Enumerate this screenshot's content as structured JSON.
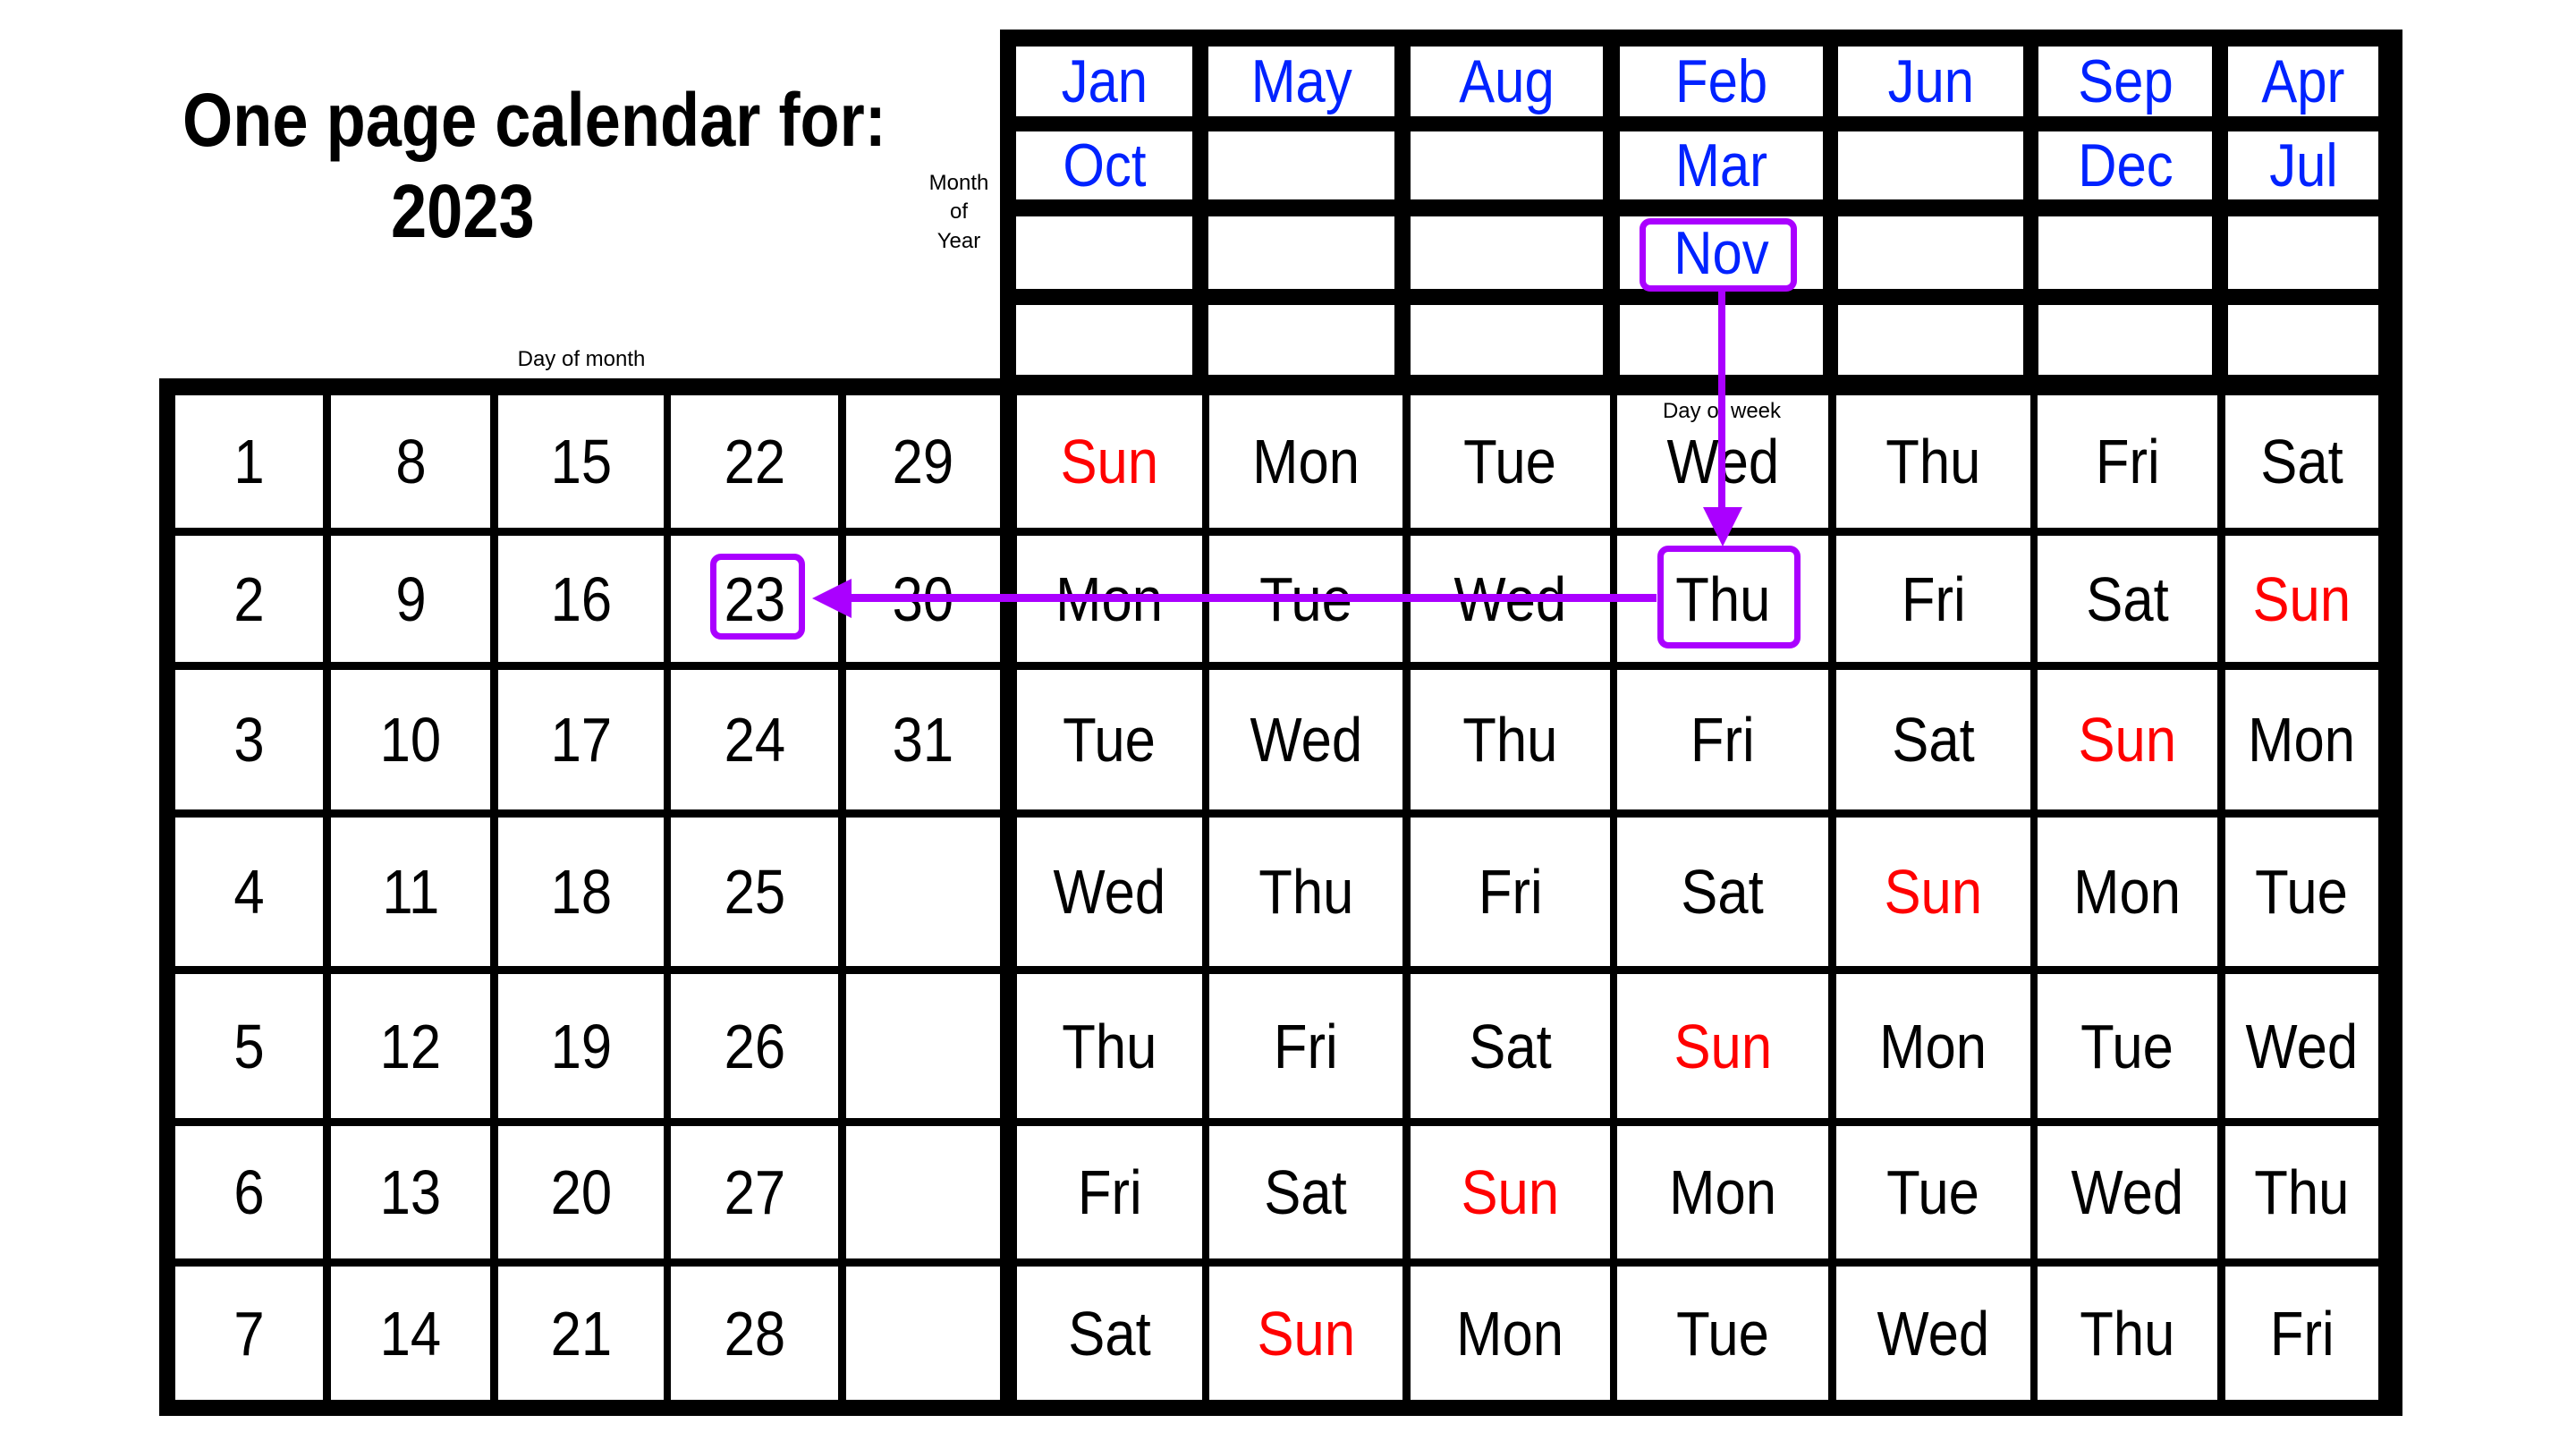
{
  "title": {
    "line1": "One page calendar for:",
    "line2": "2023"
  },
  "labels": {
    "month_of_year": [
      "Month",
      "of",
      "Year"
    ],
    "day_of_month": "Day of month",
    "day_of_week": "Day of week"
  },
  "colors": {
    "month_text": "#0022ff",
    "sunday_text": "#ff0000",
    "day_text": "#000000",
    "highlight": "#aa00ff",
    "grid": "#000000"
  },
  "month_grid": [
    [
      "Jan",
      "May",
      "Aug",
      "Feb",
      "Jun",
      "Sep",
      "Apr"
    ],
    [
      "Oct",
      "",
      "",
      "Mar",
      "",
      "Dec",
      "Jul"
    ],
    [
      "",
      "",
      "",
      "Nov",
      "",
      "",
      ""
    ],
    [
      "",
      "",
      "",
      "",
      "",
      "",
      ""
    ]
  ],
  "day_of_month_grid": [
    [
      "1",
      "8",
      "15",
      "22",
      "29"
    ],
    [
      "2",
      "9",
      "16",
      "23",
      "30"
    ],
    [
      "3",
      "10",
      "17",
      "24",
      "31"
    ],
    [
      "4",
      "11",
      "18",
      "25",
      ""
    ],
    [
      "5",
      "12",
      "19",
      "26",
      ""
    ],
    [
      "6",
      "13",
      "20",
      "27",
      ""
    ],
    [
      "7",
      "14",
      "21",
      "28",
      ""
    ]
  ],
  "day_of_week_grid": [
    [
      "Sun",
      "Mon",
      "Tue",
      "Wed",
      "Thu",
      "Fri",
      "Sat"
    ],
    [
      "Mon",
      "Tue",
      "Wed",
      "Thu",
      "Fri",
      "Sat",
      "Sun"
    ],
    [
      "Tue",
      "Wed",
      "Thu",
      "Fri",
      "Sat",
      "Sun",
      "Mon"
    ],
    [
      "Wed",
      "Thu",
      "Fri",
      "Sat",
      "Sun",
      "Mon",
      "Tue"
    ],
    [
      "Thu",
      "Fri",
      "Sat",
      "Sun",
      "Mon",
      "Tue",
      "Wed"
    ],
    [
      "Fri",
      "Sat",
      "Sun",
      "Mon",
      "Tue",
      "Wed",
      "Thu"
    ],
    [
      "Sat",
      "Sun",
      "Mon",
      "Tue",
      "Wed",
      "Thu",
      "Fri"
    ]
  ],
  "highlighted_word": "Sun",
  "example": {
    "month": "Nov",
    "month_cell": {
      "row": 2,
      "col": 3
    },
    "weekday": "Thu",
    "weekday_cell": {
      "row": 1,
      "col": 3
    },
    "day": "23",
    "day_cell": {
      "row": 1,
      "col": 3
    }
  }
}
